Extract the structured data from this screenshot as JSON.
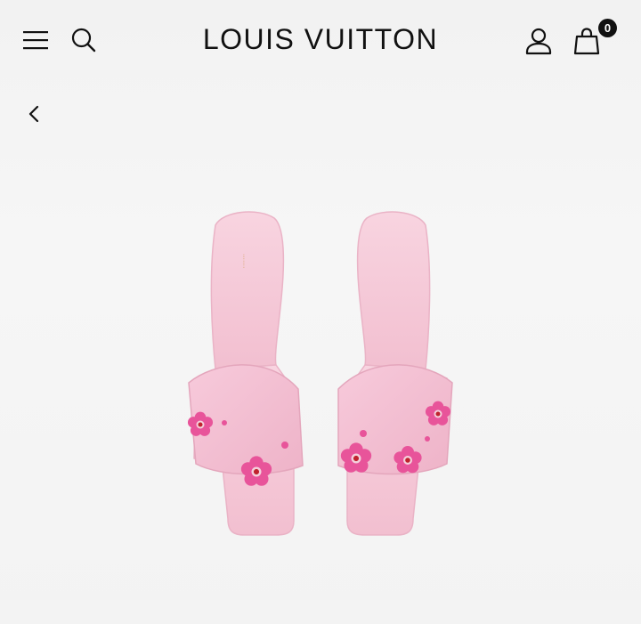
{
  "header": {
    "brand": "LOUIS VUITTON",
    "bag_count": "0",
    "icons": {
      "menu": "hamburger-menu-icon",
      "search": "search-icon",
      "account": "user-icon",
      "bag": "shopping-bag-icon",
      "back": "chevron-left-icon"
    }
  },
  "product": {
    "image": "pink-cherry-blossom-mule-sandals",
    "colors": {
      "sandal_pink": "#f6c9d8",
      "blossom_pink": "#e8549a",
      "blossom_center_red": "#c0222e"
    }
  }
}
